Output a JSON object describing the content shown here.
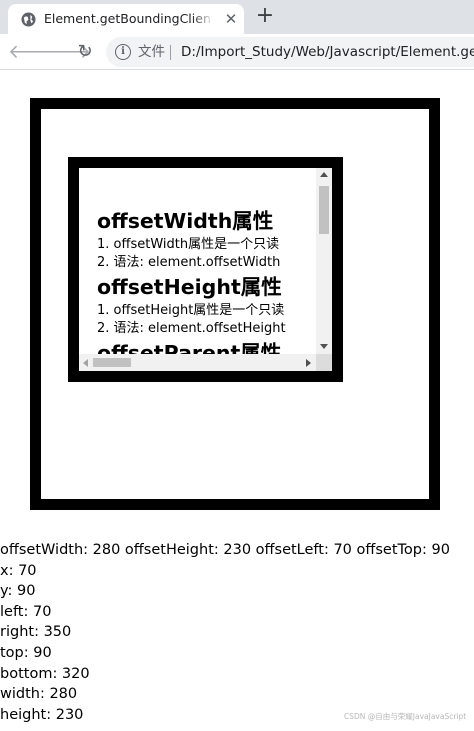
{
  "browser": {
    "tab_title": "Element.getBoundingClientRect",
    "tab_close": "✕",
    "new_tab": "+",
    "scheme_label": "文件",
    "url": "D:/Import_Study/Web/Javascript/Element.getBoundingClientRect.html",
    "icons": [
      "back-arrow-icon",
      "forward-arrow-icon",
      "reload-icon",
      "info-icon",
      "globe-icon"
    ]
  },
  "inner_content": {
    "sections": [
      {
        "heading": "offsetWidth属性",
        "lines": [
          "1. offsetWidth属性是一个只读",
          "2. 语法: element.offsetWidth"
        ]
      },
      {
        "heading": "offsetHeight属性",
        "lines": [
          "1. offsetHeight属性是一个只读",
          "2. 语法: element.offsetHeight"
        ]
      },
      {
        "heading": "offsetParent属性",
        "lines": []
      }
    ]
  },
  "output_lines": [
    "offsetWidth: 280 offsetHeight: 230 offsetLeft: 70 offsetTop: 90",
    "x: 70",
    "y: 90",
    "left: 70",
    "right: 350",
    "top: 90",
    "bottom: 320",
    "width: 280",
    "height: 230"
  ],
  "watermark": "CSDN @自由与荣耀JavaJavaScript"
}
